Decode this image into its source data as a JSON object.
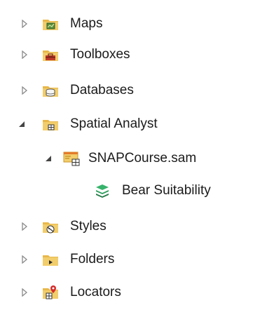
{
  "tree": {
    "items": [
      {
        "label": "Maps",
        "icon": "maps-folder-icon",
        "expanded": false,
        "level": 0
      },
      {
        "label": "Toolboxes",
        "icon": "toolbox-folder-icon",
        "expanded": false,
        "level": 0
      },
      {
        "label": "Databases",
        "icon": "database-folder-icon",
        "expanded": false,
        "level": 0
      },
      {
        "label": "Spatial Analyst",
        "icon": "spatial-analyst-folder-icon",
        "expanded": true,
        "level": 0
      },
      {
        "label": "SNAPCourse.sam",
        "icon": "model-file-icon",
        "expanded": true,
        "level": 1
      },
      {
        "label": "Bear Suitability",
        "icon": "layers-icon",
        "expanded": null,
        "level": 2
      },
      {
        "label": "Styles",
        "icon": "styles-folder-icon",
        "expanded": false,
        "level": 0
      },
      {
        "label": "Folders",
        "icon": "folders-folder-icon",
        "expanded": false,
        "level": 0
      },
      {
        "label": "Locators",
        "icon": "locators-folder-icon",
        "expanded": false,
        "level": 0
      }
    ]
  },
  "colors": {
    "folder": "#e8b84a",
    "folder_dark": "#c9962d",
    "twisty_collapsed": "#8a8a8a",
    "twisty_expanded": "#444444",
    "layers_green": "#2e9e5b"
  }
}
